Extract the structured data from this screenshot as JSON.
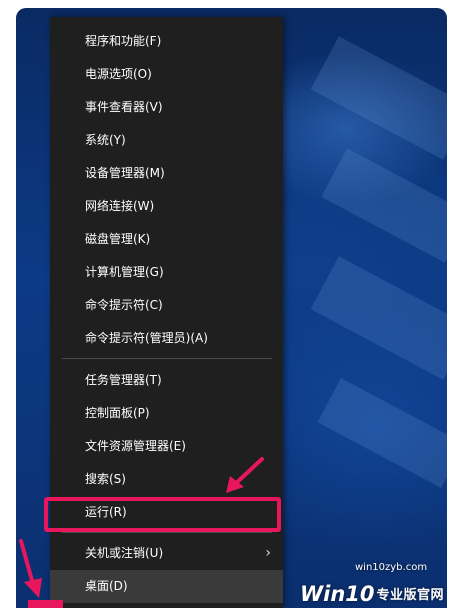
{
  "menu": {
    "items": [
      {
        "label": "程序和功能(F)"
      },
      {
        "label": "电源选项(O)"
      },
      {
        "label": "事件查看器(V)"
      },
      {
        "label": "系统(Y)"
      },
      {
        "label": "设备管理器(M)"
      },
      {
        "label": "网络连接(W)"
      },
      {
        "label": "磁盘管理(K)"
      },
      {
        "label": "计算机管理(G)"
      },
      {
        "label": "命令提示符(C)"
      },
      {
        "label": "命令提示符(管理员)(A)"
      },
      {
        "label": "任务管理器(T)"
      },
      {
        "label": "控制面板(P)"
      },
      {
        "label": "文件资源管理器(E)"
      },
      {
        "label": "搜索(S)"
      },
      {
        "label": "运行(R)"
      },
      {
        "label": "关机或注销(U)",
        "submenu_icon": "chevron-right-icon",
        "submenu_glyph": "›"
      },
      {
        "label": "桌面(D)"
      }
    ]
  },
  "annotations": {
    "highlight_color": "#e8175d",
    "highlighted_item": "运行(R)"
  },
  "watermark": {
    "url": "win10zyb.com",
    "logo": "Win10",
    "cn_text": "专业版官网"
  },
  "colors": {
    "menu_bg": "#1f1f1f",
    "menu_text": "#ffffff",
    "hover_bg": "#3a3a3a",
    "accent": "#e8175d"
  }
}
